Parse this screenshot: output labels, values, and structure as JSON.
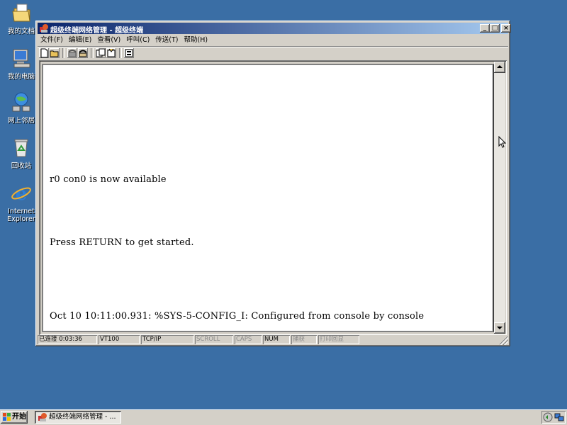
{
  "desktop": {
    "icons": [
      {
        "label": "我的文档",
        "icon": "my-documents-icon"
      },
      {
        "label": "我的电脑",
        "icon": "my-computer-icon"
      },
      {
        "label": "网上邻居",
        "icon": "network-places-icon"
      },
      {
        "label": "回收站",
        "icon": "recycle-bin-icon"
      },
      {
        "label_line1": "Internet",
        "label_line2": "Explorer",
        "icon": "internet-explorer-icon"
      }
    ]
  },
  "window": {
    "title": "超级终端网络管理 - 超级终端",
    "controls": {
      "minimize": "_",
      "maximize": "□",
      "close": "×"
    },
    "menu": [
      "文件(F)",
      "编辑(E)",
      "查看(V)",
      "呼叫(C)",
      "传送(T)",
      "帮助(H)"
    ],
    "toolbar": [
      "new-icon",
      "open-icon",
      "disconnect-phone-icon",
      "call-icon",
      "send-icon",
      "receive-icon",
      "properties-icon"
    ],
    "terminal_lines": [
      "r0 con0 is now available",
      "Press RETURN to get started.",
      "Oct 10 10:11:00.931: %SYS-5-CONFIG_I: Configured from console by console"
    ],
    "status": {
      "connected": "已连接 0:03:36",
      "emulation": "VT100",
      "protocol": "TCP/IP",
      "scroll": "SCROLL",
      "caps": "CAPS",
      "num": "NUM",
      "capture": "捕获",
      "print_echo": "打印回显"
    }
  },
  "taskbar": {
    "start_label": "开始",
    "task_label": "超级终端网络管理 - ..."
  },
  "colors": {
    "desktop": "#3a6ea5",
    "title_start": "#0a246a",
    "title_end": "#a6caf0",
    "face": "#d4d0c8"
  }
}
